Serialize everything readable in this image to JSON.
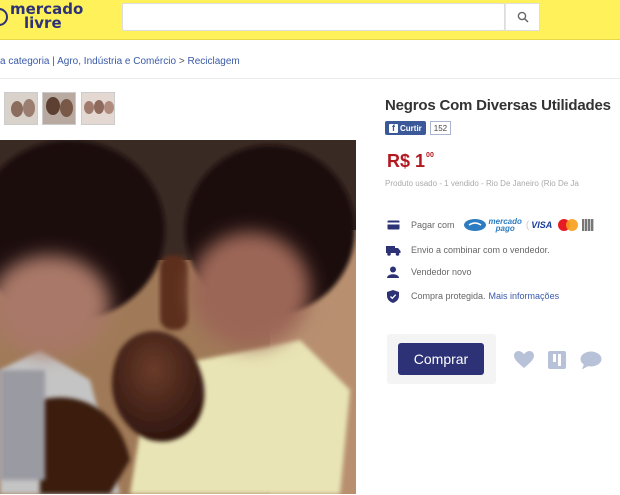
{
  "header": {
    "logo_line1": "mercado",
    "logo_line2": "livre",
    "search_placeholder": "",
    "colors": {
      "header_bg": "#fff159",
      "brand_blue": "#2d3277"
    }
  },
  "breadcrumb": {
    "items": [
      "a categoria",
      "Agro, Indústria e Comércio",
      "Reciclagem"
    ],
    "sep1": "|",
    "sep2": ">"
  },
  "product": {
    "title": "Negros Com Diversas Utilidades",
    "facebook_label": "Curtir",
    "facebook_count": "152",
    "price_currency": "R$",
    "price_integer": "1",
    "price_cents": "00",
    "meta": "Produto usado - 1 vendido - Rio De Janeiro (Rio De Ja"
  },
  "info": {
    "payment_label": "Pagar com",
    "mp_line1": "mercado",
    "mp_line2": "pago",
    "visa": "VISA",
    "shipping": "Envio a combinar com o vendedor.",
    "seller": "Vendedor novo",
    "protection": "Compra protegida.",
    "more_info_link": "Mais informações"
  },
  "actions": {
    "buy_label": "Comprar",
    "icons": [
      "heart-icon",
      "bookmark-icon",
      "chat-bubble-icon"
    ]
  }
}
